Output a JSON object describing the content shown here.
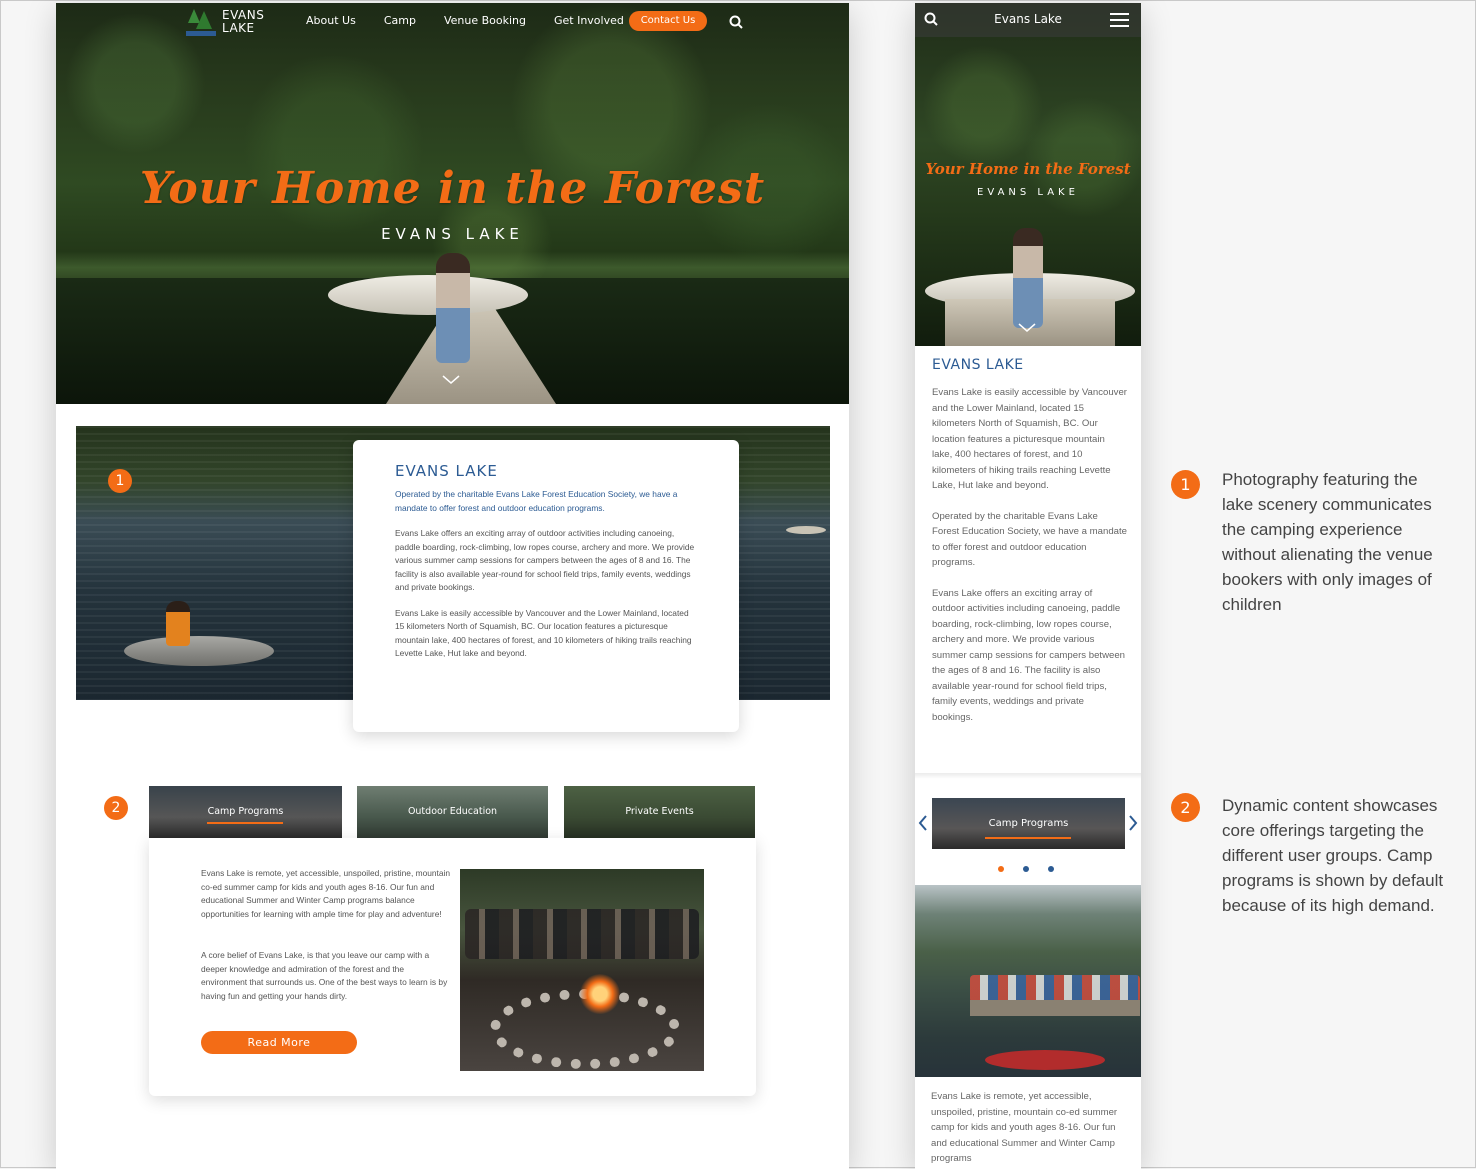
{
  "desktop": {
    "logo": {
      "line1": "EVANS",
      "line2": "LAKE"
    },
    "nav": [
      "About Us",
      "Camp",
      "Venue Booking",
      "Get Involved"
    ],
    "contact_label": "Contact Us",
    "hero_title": "Your Home in the Forest",
    "hero_subtitle": "EVANS LAKE",
    "badge1": "1",
    "badge2": "2",
    "info": {
      "title": "EVANS LAKE",
      "lead": "Operated by the charitable Evans Lake Forest Education Society, we have a mandate to offer forest and outdoor education programs.",
      "p1": "Evans Lake offers an exciting array of outdoor activities including canoeing, paddle boarding, rock-climbing, low ropes course, archery and more. We provide various summer camp sessions for campers between the ages of 8 and 16. The facility is also available year-round for school field trips, family events, weddings and private bookings.",
      "p2": "Evans Lake is easily accessible by Vancouver and the Lower Mainland, located 15 kilometers North of Squamish, BC. Our location features a picturesque mountain lake, 400 hectares of forest, and 10 kilometers of hiking trails reaching Levette Lake, Hut lake and beyond."
    },
    "tabs": [
      "Camp Programs",
      "Outdoor Education",
      "Private Events"
    ],
    "camp": {
      "p1": "Evans Lake is remote, yet accessible, unspoiled, pristine, mountain co-ed summer camp for kids and youth ages 8-16. Our fun and educational Summer and Winter Camp programs balance opportunities for learning with ample time for play and adventure!",
      "p2": "A core belief of Evans Lake, is that you leave our camp with a deeper knowledge and admiration of the forest and the environment that surrounds us. One of the best ways to learn is by having fun and getting your hands dirty.",
      "read_more": "Read More"
    }
  },
  "mobile": {
    "nav_title": "Evans Lake",
    "hero_title": "Your Home in the Forest",
    "hero_subtitle": "EVANS LAKE",
    "section_title": "EVANS LAKE",
    "p1": "Evans Lake is easily accessible by Vancouver and the Lower Mainland, located 15 kilometers North of Squamish, BC. Our location features a picturesque mountain lake, 400 hectares of forest, and 10 kilometers of hiking trails reaching Levette Lake, Hut lake and beyond.",
    "p2": "Operated by the charitable Evans Lake Forest Education Society, we have a mandate to offer forest and outdoor education programs.",
    "p3": "Evans Lake offers an exciting array of outdoor activities including canoeing, paddle boarding, rock-climbing, low ropes course, archery and more. We provide various summer camp sessions for campers between the ages of 8 and 16. The facility is also available year-round for school field trips, family events, weddings and private bookings.",
    "slider_label": "Camp Programs",
    "bottom_text": "Evans Lake is remote, yet accessible, unspoiled, pristine, mountain co-ed summer camp for kids and youth ages 8-16. Our fun and educational Summer and Winter Camp programs"
  },
  "annotations": [
    {
      "number": "1",
      "text": "Photography featuring the lake scenery communicates the camping experience without alienating the venue bookers with only images of children"
    },
    {
      "number": "2",
      "text": "Dynamic content showcases core offerings targeting the different user groups. Camp programs is shown by default because of its high demand."
    }
  ],
  "colors": {
    "accent": "#f36c16",
    "brand_blue": "#2c5b93"
  }
}
